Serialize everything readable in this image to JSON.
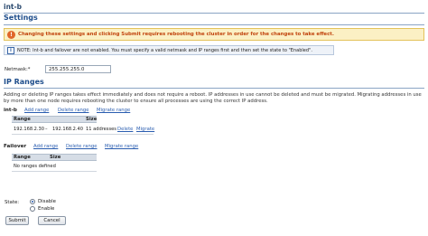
{
  "page": {
    "title": "int-b",
    "settings_heading": "Settings"
  },
  "warning": {
    "icon": "warning-icon",
    "text": "Changing these settings and clicking Submit requires rebooting the cluster in order for the changes to take effect."
  },
  "note": {
    "icon": "info-icon",
    "text": "NOTE: Int-b and failover are not enabled. You must specify a valid netmask and IP ranges first and then set the state to \"Enabled\"."
  },
  "netmask": {
    "label": "Netmask:*",
    "value": "255.255.255.0"
  },
  "ip_ranges": {
    "heading": "IP Ranges",
    "description": "Adding or deleting IP ranges takes effect immediately and does not require a reboot. IP addresses in use cannot be deleted and must be migrated. Migrating addresses in use by more than one node requires rebooting the cluster to ensure all processes are using the correct IP address."
  },
  "intb": {
    "label": "int-b",
    "add_link": "Add range",
    "delete_link": "Delete range",
    "migrate_link": "Migrate range",
    "columns": [
      "Range",
      "Size"
    ],
    "rows": [
      {
        "start": "192.168.2.30",
        "sep": "–",
        "end": "192.168.2.40",
        "size": "11 addresses",
        "delete": "Delete",
        "migrate": "Migrate"
      }
    ]
  },
  "failover": {
    "label": "Failover",
    "add_link": "Add range",
    "delete_link": "Delete range",
    "migrate_link": "Migrate range",
    "columns": [
      "Range",
      "Size"
    ],
    "empty_text": "No ranges defined"
  },
  "state": {
    "label": "State:",
    "options": [
      "Disable",
      "Enable"
    ],
    "selected": "Disable"
  },
  "buttons": {
    "submit": "Submit",
    "cancel": "Cancel"
  },
  "colors": {
    "heading": "#1f4e8c",
    "link": "#2a5db0",
    "warning_bg": "#fbf0c4",
    "warning_text": "#c1440e"
  }
}
